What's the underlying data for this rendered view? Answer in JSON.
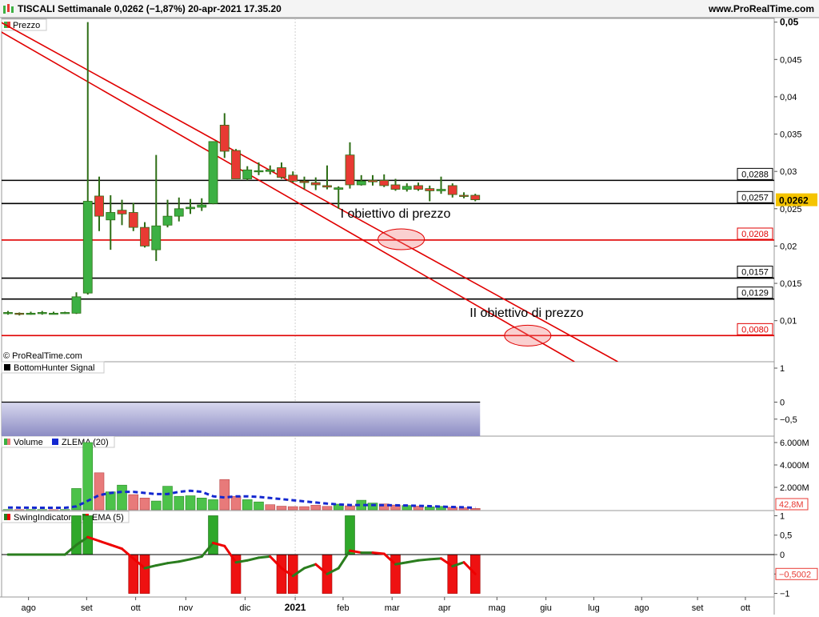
{
  "header": {
    "title": "TISCALI Settimanale 0,0262 (−1,87%) 20-apr-2021 17.35.20",
    "source": "www.ProRealTime.com",
    "copyright": "© ProRealTime.com"
  },
  "colors": {
    "up": "#3cb043",
    "down": "#e83a33",
    "wick": "#2e6e16",
    "support": "#000000",
    "target": "#e00000",
    "trend": "#e00000",
    "zlema": "#1428d0",
    "ema_up": "#2a7d1e",
    "ema_down": "#ee0000",
    "price_tag": "#f5c400"
  },
  "chart_data": [
    {
      "type": "candlestick",
      "panel_label": "Prezzo",
      "x_tick_labels": [
        "ago",
        "set",
        "ott",
        "nov",
        "dic",
        "2021",
        "feb",
        "mar",
        "apr",
        "mag",
        "giu",
        "lug",
        "ago",
        "set",
        "ott"
      ],
      "ylim": [
        0.0045,
        0.0505
      ],
      "y_ticks": [
        0.01,
        0.015,
        0.02,
        0.025,
        0.03,
        0.035,
        0.04,
        0.045,
        0.05
      ],
      "y_tick_labels": [
        "0,01",
        "0,015",
        "0,02",
        "0,025",
        "0,03",
        "0,035",
        "0,04",
        "0,045",
        "0,05"
      ],
      "last_price_label": "0,0262",
      "last_price": 0.0262,
      "candles": [
        {
          "w": 0,
          "o": 0.011,
          "h": 0.0113,
          "l": 0.0108,
          "c": 0.0111
        },
        {
          "w": 1,
          "o": 0.011,
          "h": 0.0111,
          "l": 0.0107,
          "c": 0.0109
        },
        {
          "w": 2,
          "o": 0.0109,
          "h": 0.0112,
          "l": 0.0108,
          "c": 0.011
        },
        {
          "w": 3,
          "o": 0.011,
          "h": 0.0113,
          "l": 0.0108,
          "c": 0.0111
        },
        {
          "w": 4,
          "o": 0.011,
          "h": 0.0112,
          "l": 0.0109,
          "c": 0.011
        },
        {
          "w": 5,
          "o": 0.011,
          "h": 0.0112,
          "l": 0.0109,
          "c": 0.0111
        },
        {
          "w": 6,
          "o": 0.011,
          "h": 0.0138,
          "l": 0.0109,
          "c": 0.0132
        },
        {
          "w": 7,
          "o": 0.0137,
          "h": 0.05,
          "l": 0.0135,
          "c": 0.026
        },
        {
          "w": 8,
          "o": 0.0267,
          "h": 0.0293,
          "l": 0.022,
          "c": 0.024
        },
        {
          "w": 9,
          "o": 0.0235,
          "h": 0.0268,
          "l": 0.0195,
          "c": 0.0245
        },
        {
          "w": 10,
          "o": 0.0248,
          "h": 0.0262,
          "l": 0.0228,
          "c": 0.0243
        },
        {
          "w": 11,
          "o": 0.0245,
          "h": 0.0258,
          "l": 0.022,
          "c": 0.0225
        },
        {
          "w": 12,
          "o": 0.0225,
          "h": 0.0232,
          "l": 0.0198,
          "c": 0.02
        },
        {
          "w": 13,
          "o": 0.0195,
          "h": 0.0322,
          "l": 0.018,
          "c": 0.0227
        },
        {
          "w": 14,
          "o": 0.0228,
          "h": 0.0262,
          "l": 0.0225,
          "c": 0.024
        },
        {
          "w": 15,
          "o": 0.024,
          "h": 0.0265,
          "l": 0.0233,
          "c": 0.025
        },
        {
          "w": 16,
          "o": 0.025,
          "h": 0.0263,
          "l": 0.0243,
          "c": 0.0252
        },
        {
          "w": 17,
          "o": 0.0252,
          "h": 0.0264,
          "l": 0.0247,
          "c": 0.0255
        },
        {
          "w": 18,
          "o": 0.0257,
          "h": 0.034,
          "l": 0.0256,
          "c": 0.034
        },
        {
          "w": 19,
          "o": 0.0362,
          "h": 0.0378,
          "l": 0.0318,
          "c": 0.0327
        },
        {
          "w": 20,
          "o": 0.0328,
          "h": 0.033,
          "l": 0.029,
          "c": 0.029
        },
        {
          "w": 21,
          "o": 0.029,
          "h": 0.0307,
          "l": 0.0288,
          "c": 0.0302
        },
        {
          "w": 22,
          "o": 0.03,
          "h": 0.0312,
          "l": 0.0295,
          "c": 0.0301
        },
        {
          "w": 23,
          "o": 0.03,
          "h": 0.0308,
          "l": 0.0296,
          "c": 0.0302
        },
        {
          "w": 24,
          "o": 0.0305,
          "h": 0.0312,
          "l": 0.029,
          "c": 0.0292
        },
        {
          "w": 25,
          "o": 0.0295,
          "h": 0.03,
          "l": 0.0285,
          "c": 0.0287
        },
        {
          "w": 26,
          "o": 0.0287,
          "h": 0.0293,
          "l": 0.0276,
          "c": 0.0285
        },
        {
          "w": 27,
          "o": 0.0285,
          "h": 0.0292,
          "l": 0.0275,
          "c": 0.0282
        },
        {
          "w": 28,
          "o": 0.0281,
          "h": 0.0308,
          "l": 0.0276,
          "c": 0.0279
        },
        {
          "w": 29,
          "o": 0.0276,
          "h": 0.028,
          "l": 0.025,
          "c": 0.0278
        },
        {
          "w": 30,
          "o": 0.0322,
          "h": 0.0339,
          "l": 0.0277,
          "c": 0.0282
        },
        {
          "w": 31,
          "o": 0.0282,
          "h": 0.0295,
          "l": 0.0281,
          "c": 0.0287
        },
        {
          "w": 32,
          "o": 0.0288,
          "h": 0.0295,
          "l": 0.0281,
          "c": 0.0286
        },
        {
          "w": 33,
          "o": 0.0288,
          "h": 0.0296,
          "l": 0.0279,
          "c": 0.0281
        },
        {
          "w": 34,
          "o": 0.0282,
          "h": 0.029,
          "l": 0.0274,
          "c": 0.0276
        },
        {
          "w": 35,
          "o": 0.0276,
          "h": 0.0284,
          "l": 0.0273,
          "c": 0.028
        },
        {
          "w": 36,
          "o": 0.0281,
          "h": 0.0285,
          "l": 0.0274,
          "c": 0.0276
        },
        {
          "w": 37,
          "o": 0.0277,
          "h": 0.0281,
          "l": 0.026,
          "c": 0.0274
        },
        {
          "w": 38,
          "o": 0.0274,
          "h": 0.0293,
          "l": 0.027,
          "c": 0.0276
        },
        {
          "w": 39,
          "o": 0.0281,
          "h": 0.0284,
          "l": 0.0265,
          "c": 0.0269
        },
        {
          "w": 40,
          "o": 0.0268,
          "h": 0.0272,
          "l": 0.0264,
          "c": 0.0267
        },
        {
          "w": 41,
          "o": 0.0268,
          "h": 0.027,
          "l": 0.026,
          "c": 0.0262
        }
      ],
      "levels": [
        {
          "value": 0.0288,
          "label": "0,0288",
          "kind": "support"
        },
        {
          "value": 0.0257,
          "label": "0,0257",
          "kind": "support"
        },
        {
          "value": 0.0208,
          "label": "0,0208",
          "kind": "target"
        },
        {
          "value": 0.0157,
          "label": "0,0157",
          "kind": "support"
        },
        {
          "value": 0.0129,
          "label": "0,0129",
          "kind": "support"
        },
        {
          "value": 0.008,
          "label": "0,0080",
          "kind": "target"
        }
      ],
      "trendlines": [
        {
          "from": {
            "w": -1,
            "v": 0.0503
          },
          "to": {
            "w": 53.5,
            "v": 0.0045
          }
        },
        {
          "from": {
            "w": -3,
            "v": 0.0508
          },
          "to": {
            "w": 49.7,
            "v": 0.0045
          }
        }
      ],
      "annotations": [
        {
          "text": "I obiettivo di prezzo",
          "w": 34.0,
          "v": 0.0238,
          "target_w": 34.5,
          "target_v": 0.0209
        },
        {
          "text": "II obiettivo di prezzo",
          "w": 45.5,
          "v": 0.0105,
          "target_w": 45.6,
          "target_v": 0.008
        }
      ]
    },
    {
      "type": "area",
      "panel_label": "BottomHunter Signal",
      "ylim": [
        -1,
        1
      ],
      "y_ticks": [
        1,
        0,
        -0.5
      ],
      "y_tick_labels": [
        "1",
        "0",
        "−0,5"
      ],
      "value": -1,
      "last_week": 41
    },
    {
      "type": "bar",
      "panel_label": "Volume",
      "series_labels": [
        "Volume",
        "ZLEMA (20)"
      ],
      "unit": "M",
      "ylim": [
        0,
        6000
      ],
      "y_ticks": [
        2000,
        4000,
        6000
      ],
      "y_tick_labels": [
        "2.000M",
        "4.000M",
        "6.000M"
      ],
      "last_label": "42,8M",
      "values": [
        20,
        15,
        20,
        18,
        12,
        22,
        1900,
        6000,
        3300,
        1600,
        2200,
        1350,
        1050,
        780,
        2100,
        1200,
        1250,
        1050,
        900,
        2700,
        1200,
        900,
        700,
        450,
        320,
        280,
        280,
        400,
        300,
        500,
        350,
        850,
        600,
        520,
        420,
        380,
        320,
        260,
        300,
        220,
        180,
        120
      ],
      "up": [
        true,
        false,
        true,
        true,
        false,
        true,
        true,
        true,
        false,
        true,
        true,
        false,
        false,
        true,
        true,
        true,
        true,
        true,
        true,
        false,
        false,
        true,
        true,
        false,
        false,
        false,
        false,
        false,
        false,
        true,
        false,
        true,
        true,
        false,
        false,
        true,
        false,
        true,
        true,
        false,
        false,
        false
      ],
      "zlema": [
        200,
        190,
        185,
        180,
        175,
        175,
        300,
        800,
        1300,
        1500,
        1600,
        1600,
        1500,
        1400,
        1400,
        1600,
        1700,
        1600,
        1200,
        1100,
        1200,
        1200,
        1150,
        1050,
        950,
        850,
        750,
        650,
        550,
        480,
        420,
        420,
        420,
        410,
        400,
        380,
        350,
        320,
        280,
        250,
        220,
        180
      ]
    },
    {
      "type": "bar",
      "panel_label": "SwingIndicator",
      "series_labels": [
        "SwingIndicator",
        "EMA (5)"
      ],
      "ylim": [
        -1.05,
        1.05
      ],
      "y_ticks": [
        1,
        0.5,
        0,
        -0.5,
        -1
      ],
      "y_tick_labels": [
        "1",
        "0,5",
        "0",
        "−0,5",
        "−1"
      ],
      "last_label": "−0,5002",
      "bars": [
        {
          "w": 6,
          "v": 1
        },
        {
          "w": 7,
          "v": 1
        },
        {
          "w": 11,
          "v": -1
        },
        {
          "w": 12,
          "v": -1
        },
        {
          "w": 18,
          "v": 1
        },
        {
          "w": 20,
          "v": -1
        },
        {
          "w": 24,
          "v": -1
        },
        {
          "w": 25,
          "v": -1
        },
        {
          "w": 28,
          "v": -1
        },
        {
          "w": 30,
          "v": 1
        },
        {
          "w": 34,
          "v": -1
        },
        {
          "w": 39,
          "v": -1
        },
        {
          "w": 41,
          "v": -1
        }
      ],
      "ema": [
        0,
        0,
        0,
        0,
        0,
        0,
        0.25,
        0.45,
        0.35,
        0.25,
        0.15,
        -0.1,
        -0.35,
        -0.28,
        -0.22,
        -0.18,
        -0.12,
        -0.05,
        0.3,
        0.22,
        -0.2,
        -0.15,
        -0.08,
        -0.05,
        -0.35,
        -0.55,
        -0.35,
        -0.25,
        -0.5,
        -0.35,
        0.1,
        0.05,
        0.05,
        0.02,
        -0.25,
        -0.2,
        -0.15,
        -0.12,
        -0.1,
        -0.3,
        -0.2,
        -0.5
      ]
    }
  ]
}
